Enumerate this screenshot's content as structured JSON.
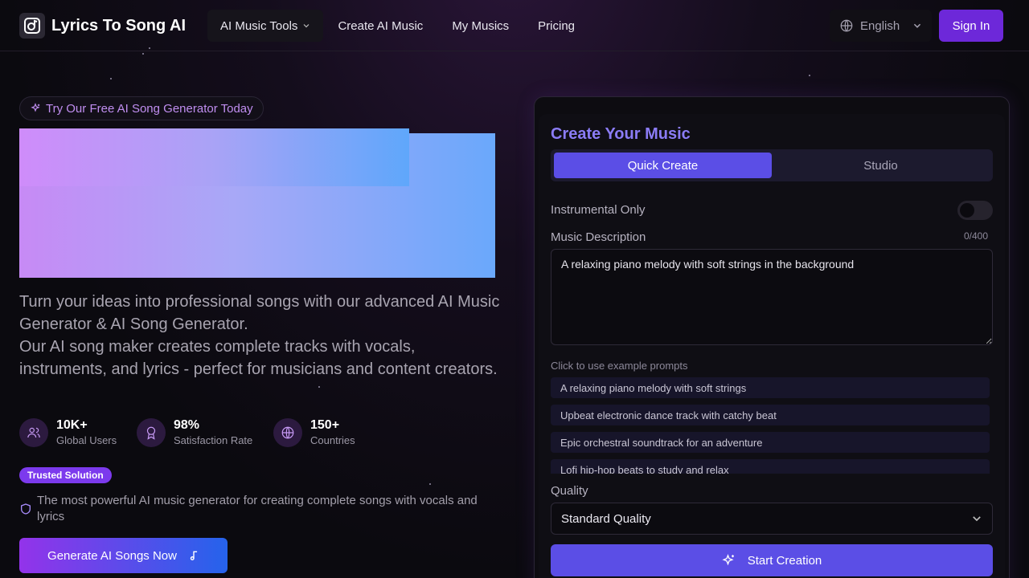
{
  "header": {
    "app_name": "Lyrics To Song AI",
    "nav": [
      {
        "label": "AI Music Tools"
      },
      {
        "label": "Create AI Music"
      },
      {
        "label": "My Musics"
      },
      {
        "label": "Pricing"
      }
    ],
    "language": "English",
    "sign_in": "Sign In"
  },
  "hero": {
    "badge": "Try Our Free AI Song Generator Today",
    "line1": "Turn your ideas into professional songs with our advanced AI Music Generator & AI Song Generator.",
    "line2": "Our AI song maker creates complete tracks with vocals, instruments, and lyrics - perfect for musicians and content creators.",
    "stats": [
      {
        "value": "10K+",
        "label": "Global Users",
        "icon": "users-icon"
      },
      {
        "value": "98%",
        "label": "Satisfaction Rate",
        "icon": "award-icon"
      },
      {
        "value": "150+",
        "label": "Countries",
        "icon": "globe-icon"
      }
    ],
    "trusted_badge": "Trusted Solution",
    "powerful_text": "The most powerful AI music generator for creating complete songs with vocals and lyrics",
    "cta": "Generate AI Songs Now"
  },
  "create_panel": {
    "title": "Create Your Music",
    "tabs": [
      {
        "label": "Quick Create",
        "active": true
      },
      {
        "label": "Studio",
        "active": false
      }
    ],
    "instrumental_label": "Instrumental Only",
    "instrumental_on": false,
    "description_label": "Music Description",
    "char_count": "0/400",
    "description_value": "A relaxing piano melody with soft strings in the background",
    "examples_label": "Click to use example prompts",
    "examples": [
      "A relaxing piano melody with soft strings",
      "Upbeat electronic dance track with catchy beat",
      "Epic orchestral soundtrack for an adventure",
      "Lofi hip-hop beats to study and relax"
    ],
    "quality_label": "Quality",
    "quality_value": "Standard Quality",
    "start_button": "Start Creation"
  },
  "colors": {
    "accent": "#5b4ee6",
    "brand_purple": "#6d28d9",
    "title_purple": "#8b7cf6",
    "background": "#0b0a0f"
  }
}
